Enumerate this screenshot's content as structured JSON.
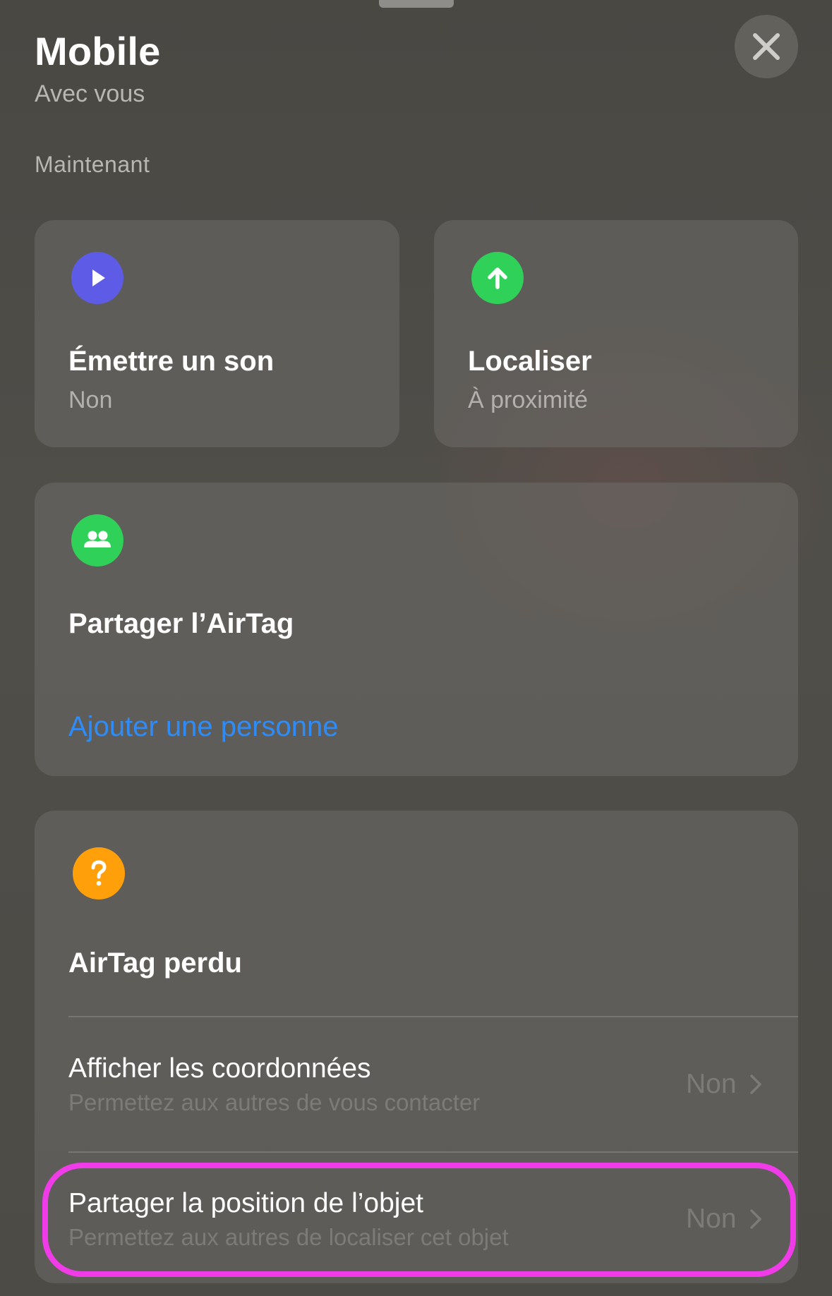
{
  "header": {
    "title": "Mobile",
    "subtitle": "Avec vous",
    "close_icon": "close-icon"
  },
  "section": {
    "label": "Maintenant"
  },
  "cards": {
    "sound": {
      "icon": "play-icon",
      "icon_color": "#5e5ce6",
      "title": "Émettre un son",
      "status": "Non"
    },
    "locate": {
      "icon": "arrow-up-icon",
      "icon_color": "#30d158",
      "title": "Localiser",
      "status": "À proximité"
    },
    "share": {
      "icon": "people-icon",
      "icon_color": "#30d158",
      "title": "Partager l’AirTag",
      "link": "Ajouter une personne",
      "link_color": "#2f8cf7"
    },
    "lost": {
      "icon": "question-icon",
      "icon_color": "#ff9f0a",
      "title": "AirTag perdu",
      "rows": [
        {
          "title": "Afficher les coordonnées",
          "subtitle": "Permettez aux autres de vous contacter",
          "value": "Non"
        },
        {
          "title": "Partager la position de l’objet",
          "subtitle": "Permettez aux autres de localiser cet objet",
          "value": "Non"
        }
      ]
    }
  },
  "annotation": {
    "highlight_color": "#f03ce8"
  }
}
